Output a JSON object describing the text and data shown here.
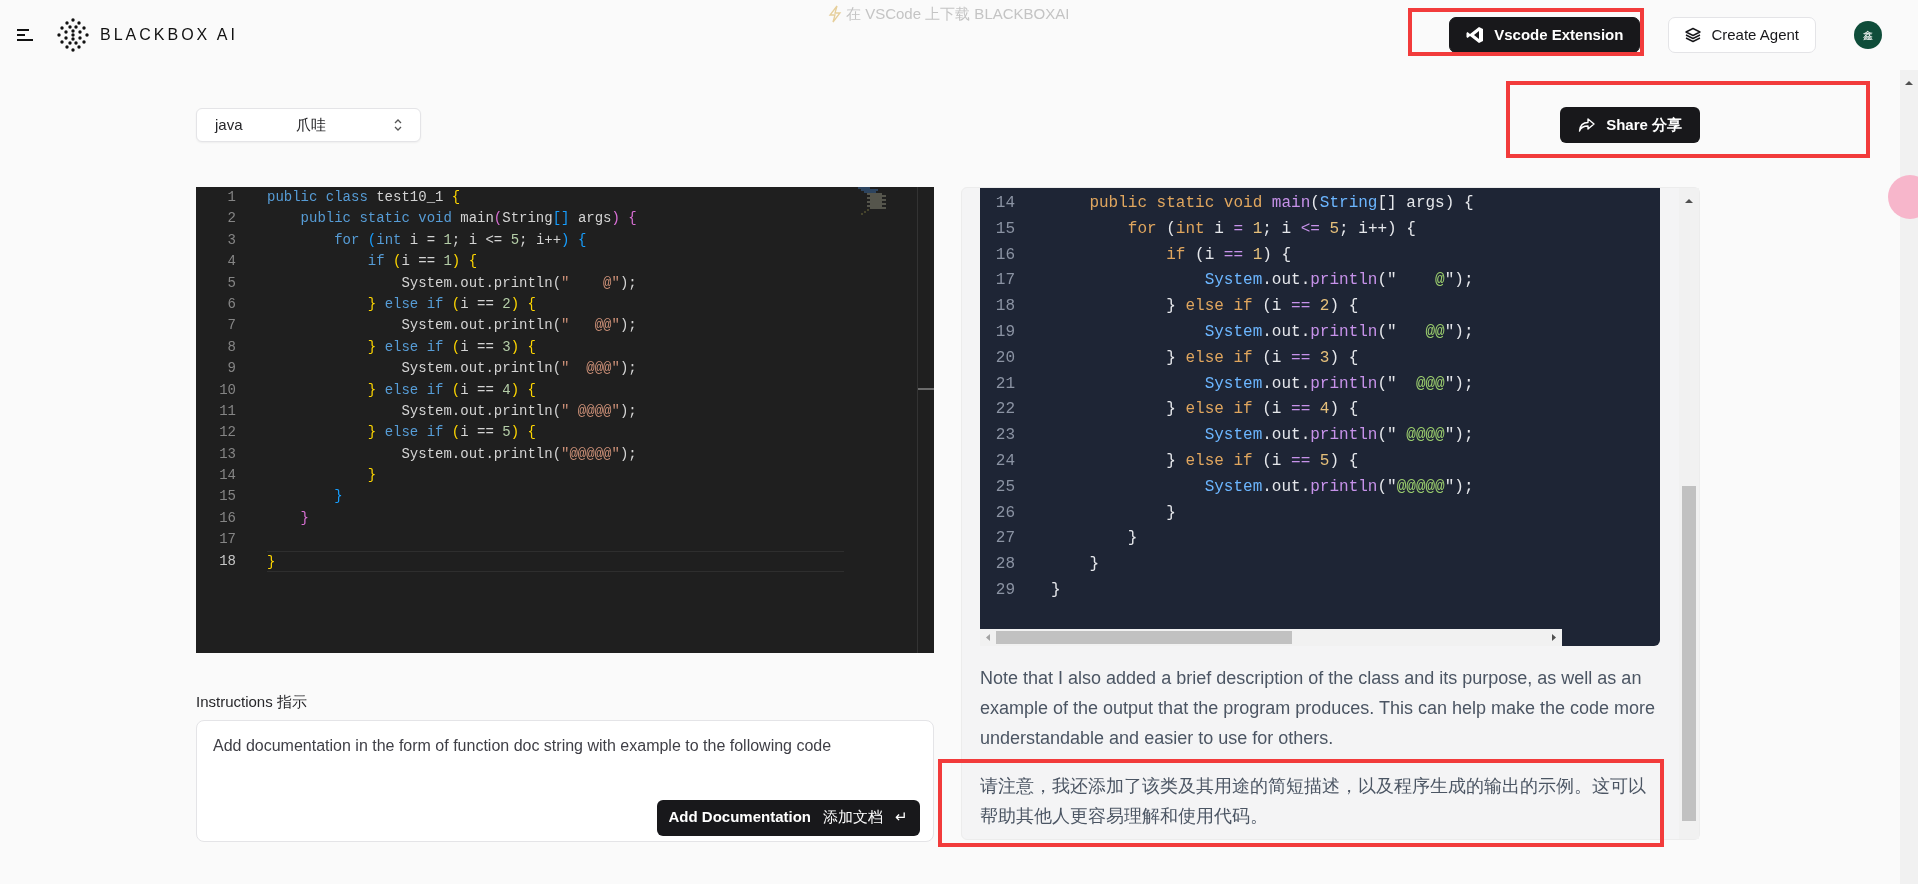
{
  "header": {
    "brand": "BLACKBOX AI",
    "banner": "在 VSCode 上下载 BLACKBOXAI",
    "buttons": [
      {
        "label": "Vscode Extension",
        "kind": "dark"
      },
      {
        "label": "Create Agent",
        "kind": "light"
      }
    ],
    "avatar": "鑫"
  },
  "language_select": {
    "value": "java",
    "translation": "爪哇"
  },
  "share_button": {
    "label": "Share 分享"
  },
  "editor": {
    "lines": [
      {
        "n": "1",
        "tokens": [
          {
            "text": "public class ",
            "kind": "kw"
          },
          {
            "text": "test10_1 ",
            "kind": "p"
          },
          {
            "text": "{",
            "kind": "b1"
          }
        ],
        "current": false
      },
      {
        "n": "2",
        "tokens": [
          {
            "text": "    public static void ",
            "kind": "kw"
          },
          {
            "text": "main",
            "kind": "p"
          },
          {
            "text": "(",
            "kind": "b2"
          },
          {
            "text": "String",
            "kind": "p"
          },
          {
            "text": "[]",
            "kind": "b3"
          },
          {
            "text": " args",
            "kind": "p"
          },
          {
            "text": ") {",
            "kind": "b2"
          }
        ],
        "current": false
      },
      {
        "n": "3",
        "tokens": [
          {
            "text": "        for ",
            "kind": "kw"
          },
          {
            "text": "(",
            "kind": "b3"
          },
          {
            "text": "int ",
            "kind": "kw"
          },
          {
            "text": "i = ",
            "kind": "p"
          },
          {
            "text": "1",
            "kind": "num"
          },
          {
            "text": "; i <= ",
            "kind": "p"
          },
          {
            "text": "5",
            "kind": "num"
          },
          {
            "text": "; i++",
            "kind": "p"
          },
          {
            "text": ") {",
            "kind": "b3"
          }
        ],
        "current": false
      },
      {
        "n": "4",
        "tokens": [
          {
            "text": "            if ",
            "kind": "kw"
          },
          {
            "text": "(",
            "kind": "b1"
          },
          {
            "text": "i == ",
            "kind": "p"
          },
          {
            "text": "1",
            "kind": "num"
          },
          {
            "text": ") {",
            "kind": "b1"
          }
        ],
        "current": false
      },
      {
        "n": "5",
        "tokens": [
          {
            "text": "                System.out.println(",
            "kind": "p"
          },
          {
            "text": "\"    @\"",
            "kind": "str"
          },
          {
            "text": ");",
            "kind": "p"
          }
        ],
        "current": false
      },
      {
        "n": "6",
        "tokens": [
          {
            "text": "            } ",
            "kind": "b1"
          },
          {
            "text": "else if ",
            "kind": "kw"
          },
          {
            "text": "(",
            "kind": "b1"
          },
          {
            "text": "i == ",
            "kind": "p"
          },
          {
            "text": "2",
            "kind": "num"
          },
          {
            "text": ") {",
            "kind": "b1"
          }
        ],
        "current": false
      },
      {
        "n": "7",
        "tokens": [
          {
            "text": "                System.out.println(",
            "kind": "p"
          },
          {
            "text": "\"   @@\"",
            "kind": "str"
          },
          {
            "text": ");",
            "kind": "p"
          }
        ],
        "current": false
      },
      {
        "n": "8",
        "tokens": [
          {
            "text": "            } ",
            "kind": "b1"
          },
          {
            "text": "else if ",
            "kind": "kw"
          },
          {
            "text": "(",
            "kind": "b1"
          },
          {
            "text": "i == ",
            "kind": "p"
          },
          {
            "text": "3",
            "kind": "num"
          },
          {
            "text": ") {",
            "kind": "b1"
          }
        ],
        "current": false
      },
      {
        "n": "9",
        "tokens": [
          {
            "text": "                System.out.println(",
            "kind": "p"
          },
          {
            "text": "\"  @@@\"",
            "kind": "str"
          },
          {
            "text": ");",
            "kind": "p"
          }
        ],
        "current": false
      },
      {
        "n": "10",
        "tokens": [
          {
            "text": "            } ",
            "kind": "b1"
          },
          {
            "text": "else if ",
            "kind": "kw"
          },
          {
            "text": "(",
            "kind": "b1"
          },
          {
            "text": "i == ",
            "kind": "p"
          },
          {
            "text": "4",
            "kind": "num"
          },
          {
            "text": ") {",
            "kind": "b1"
          }
        ],
        "current": false
      },
      {
        "n": "11",
        "tokens": [
          {
            "text": "                System.out.println(",
            "kind": "p"
          },
          {
            "text": "\" @@@@\"",
            "kind": "str"
          },
          {
            "text": ");",
            "kind": "p"
          }
        ],
        "current": false
      },
      {
        "n": "12",
        "tokens": [
          {
            "text": "            } ",
            "kind": "b1"
          },
          {
            "text": "else if ",
            "kind": "kw"
          },
          {
            "text": "(",
            "kind": "b1"
          },
          {
            "text": "i == ",
            "kind": "p"
          },
          {
            "text": "5",
            "kind": "num"
          },
          {
            "text": ") {",
            "kind": "b1"
          }
        ],
        "current": false
      },
      {
        "n": "13",
        "tokens": [
          {
            "text": "                System.out.println(",
            "kind": "p"
          },
          {
            "text": "\"@@@@@\"",
            "kind": "str"
          },
          {
            "text": ");",
            "kind": "p"
          }
        ],
        "current": false
      },
      {
        "n": "14",
        "tokens": [
          {
            "text": "            }",
            "kind": "b1"
          }
        ],
        "current": false
      },
      {
        "n": "15",
        "tokens": [
          {
            "text": "        }",
            "kind": "b3"
          }
        ],
        "current": false
      },
      {
        "n": "16",
        "tokens": [
          {
            "text": "    }",
            "kind": "b2"
          }
        ],
        "current": false
      },
      {
        "n": "17",
        "current": false
      },
      {
        "n": "18",
        "tokens": [
          {
            "text": "}",
            "kind": "b1"
          }
        ],
        "current": true
      }
    ]
  },
  "instructions": {
    "label": "Instructions 指示",
    "value": "Add documentation in the form of function doc string with example to the following code",
    "submit": "Add Documentation",
    "submit_translation": "添加文档",
    "submit_key": "↵"
  },
  "result": {
    "lines": [
      {
        "n": "14",
        "tokens": [
          {
            "text": "    public static void ",
            "kind": "kw"
          },
          {
            "text": "main",
            "kind": "fn"
          },
          {
            "text": "(",
            "kind": "p"
          },
          {
            "text": "String",
            "kind": "type"
          },
          {
            "text": "[] args) {",
            "kind": "p"
          }
        ]
      },
      {
        "n": "15",
        "tokens": [
          {
            "text": "        for ",
            "kind": "kw"
          },
          {
            "text": "(",
            "kind": "p"
          },
          {
            "text": "int ",
            "kind": "kw"
          },
          {
            "text": "i ",
            "kind": "p"
          },
          {
            "text": "= ",
            "kind": "op"
          },
          {
            "text": "1",
            "kind": "num"
          },
          {
            "text": "; i ",
            "kind": "p"
          },
          {
            "text": "<= ",
            "kind": "op"
          },
          {
            "text": "5",
            "kind": "num"
          },
          {
            "text": "; i++) {",
            "kind": "p"
          }
        ]
      },
      {
        "n": "16",
        "tokens": [
          {
            "text": "            if ",
            "kind": "kw"
          },
          {
            "text": "(i ",
            "kind": "p"
          },
          {
            "text": "== ",
            "kind": "op"
          },
          {
            "text": "1",
            "kind": "num"
          },
          {
            "text": ") {",
            "kind": "p"
          }
        ]
      },
      {
        "n": "17",
        "tokens": [
          {
            "text": "                System",
            "kind": "type"
          },
          {
            "text": ".out.",
            "kind": "p"
          },
          {
            "text": "println",
            "kind": "fn"
          },
          {
            "text": "(\"",
            "kind": "p"
          },
          {
            "text": "    @",
            "kind": "str"
          },
          {
            "text": "\");",
            "kind": "p"
          }
        ]
      },
      {
        "n": "18",
        "tokens": [
          {
            "text": "            } ",
            "kind": "p"
          },
          {
            "text": "else if ",
            "kind": "kw"
          },
          {
            "text": "(i ",
            "kind": "p"
          },
          {
            "text": "== ",
            "kind": "op"
          },
          {
            "text": "2",
            "kind": "num"
          },
          {
            "text": ") {",
            "kind": "p"
          }
        ]
      },
      {
        "n": "19",
        "tokens": [
          {
            "text": "                System",
            "kind": "type"
          },
          {
            "text": ".out.",
            "kind": "p"
          },
          {
            "text": "println",
            "kind": "fn"
          },
          {
            "text": "(\"",
            "kind": "p"
          },
          {
            "text": "   @@",
            "kind": "str"
          },
          {
            "text": "\");",
            "kind": "p"
          }
        ]
      },
      {
        "n": "20",
        "tokens": [
          {
            "text": "            } ",
            "kind": "p"
          },
          {
            "text": "else if ",
            "kind": "kw"
          },
          {
            "text": "(i ",
            "kind": "p"
          },
          {
            "text": "== ",
            "kind": "op"
          },
          {
            "text": "3",
            "kind": "num"
          },
          {
            "text": ") {",
            "kind": "p"
          }
        ]
      },
      {
        "n": "21",
        "tokens": [
          {
            "text": "                System",
            "kind": "type"
          },
          {
            "text": ".out.",
            "kind": "p"
          },
          {
            "text": "println",
            "kind": "fn"
          },
          {
            "text": "(\"",
            "kind": "p"
          },
          {
            "text": "  @@@",
            "kind": "str"
          },
          {
            "text": "\");",
            "kind": "p"
          }
        ]
      },
      {
        "n": "22",
        "tokens": [
          {
            "text": "            } ",
            "kind": "p"
          },
          {
            "text": "else if ",
            "kind": "kw"
          },
          {
            "text": "(i ",
            "kind": "p"
          },
          {
            "text": "== ",
            "kind": "op"
          },
          {
            "text": "4",
            "kind": "num"
          },
          {
            "text": ") {",
            "kind": "p"
          }
        ]
      },
      {
        "n": "23",
        "tokens": [
          {
            "text": "                System",
            "kind": "type"
          },
          {
            "text": ".out.",
            "kind": "p"
          },
          {
            "text": "println",
            "kind": "fn"
          },
          {
            "text": "(\"",
            "kind": "p"
          },
          {
            "text": " @@@@",
            "kind": "str"
          },
          {
            "text": "\");",
            "kind": "p"
          }
        ]
      },
      {
        "n": "24",
        "tokens": [
          {
            "text": "            } ",
            "kind": "p"
          },
          {
            "text": "else if ",
            "kind": "kw"
          },
          {
            "text": "(i ",
            "kind": "p"
          },
          {
            "text": "== ",
            "kind": "op"
          },
          {
            "text": "5",
            "kind": "num"
          },
          {
            "text": ") {",
            "kind": "p"
          }
        ]
      },
      {
        "n": "25",
        "tokens": [
          {
            "text": "                System",
            "kind": "type"
          },
          {
            "text": ".out.",
            "kind": "p"
          },
          {
            "text": "println",
            "kind": "fn"
          },
          {
            "text": "(\"",
            "kind": "p"
          },
          {
            "text": "@@@@@",
            "kind": "str"
          },
          {
            "text": "\");",
            "kind": "p"
          }
        ]
      },
      {
        "n": "26",
        "tokens": [
          {
            "text": "            }",
            "kind": "p"
          }
        ]
      },
      {
        "n": "27",
        "tokens": [
          {
            "text": "        }",
            "kind": "p"
          }
        ]
      },
      {
        "n": "28",
        "tokens": [
          {
            "text": "    }",
            "kind": "p"
          }
        ]
      },
      {
        "n": "29",
        "tokens": [
          {
            "text": "}",
            "kind": "p"
          }
        ]
      }
    ],
    "paragraphs": [
      "Note that I also added a brief description of the class and its purpose, as well as an example of the output that the program produces. This can help make the code more understandable and easier to use for others.",
      "请注意，我还添加了该类及其用途的简短描述，以及程序生成的输出的示例。这可以帮助其他人更容易理解和使用代码。"
    ]
  }
}
